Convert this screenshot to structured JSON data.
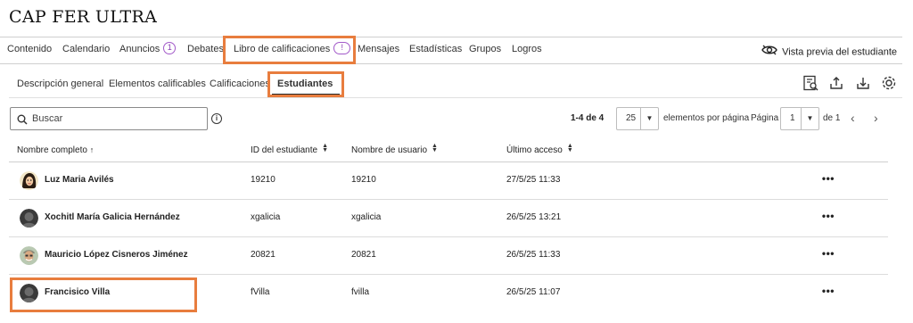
{
  "course": {
    "title": "CAP FER ULTRA"
  },
  "nav": {
    "items": [
      {
        "label": "Contenido"
      },
      {
        "label": "Calendario"
      },
      {
        "label": "Anuncios",
        "badge": "1"
      },
      {
        "label": "Debates"
      },
      {
        "label": "Libro de calificaciones",
        "badge": "!",
        "active": true
      },
      {
        "label": "Mensajes"
      },
      {
        "label": "Estadísticas"
      },
      {
        "label": "Grupos"
      },
      {
        "label": "Logros"
      }
    ],
    "preview_label": "Vista previa del estudiante"
  },
  "subnav": {
    "items": [
      {
        "label": "Descripción general"
      },
      {
        "label": "Elementos calificables"
      },
      {
        "label": "Calificaciones"
      },
      {
        "label": "Estudiantes",
        "active": true
      }
    ],
    "icons": [
      "report-icon",
      "export-icon",
      "download-icon",
      "settings-icon"
    ]
  },
  "toolbar": {
    "search_placeholder": "Buscar",
    "info_glyph": "i",
    "result_count": "1-4 de 4",
    "per_page_value": "25",
    "per_page_label": "elementos por página",
    "page_label": "Página",
    "page_value": "1",
    "page_of": "de 1"
  },
  "table": {
    "headers": {
      "name": "Nombre completo",
      "student_id": "ID del estudiante",
      "username": "Nombre de usuario",
      "last_access": "Último acceso"
    },
    "rows": [
      {
        "name": "Luz Maria Avilés",
        "student_id": "19210",
        "username": "19210",
        "last_access": "27/5/25 11:33",
        "avatar": "cartoon"
      },
      {
        "name": "Xochitl María Galicia Hernández",
        "student_id": "xgalicia",
        "username": "xgalicia",
        "last_access": "26/5/25 13:21",
        "avatar": "default"
      },
      {
        "name": "Mauricio López Cisneros Jiménez",
        "student_id": "20821",
        "username": "20821",
        "last_access": "26/5/25 11:33",
        "avatar": "photo"
      },
      {
        "name": "Francisico Villa",
        "student_id": "fVilla",
        "username": "fvilla",
        "last_access": "26/5/25 11:07",
        "avatar": "default"
      }
    ],
    "more_glyph": "•••"
  },
  "colors": {
    "highlight": "#e87d3e",
    "badge": "#a259c9",
    "active_underline": "#262626"
  }
}
